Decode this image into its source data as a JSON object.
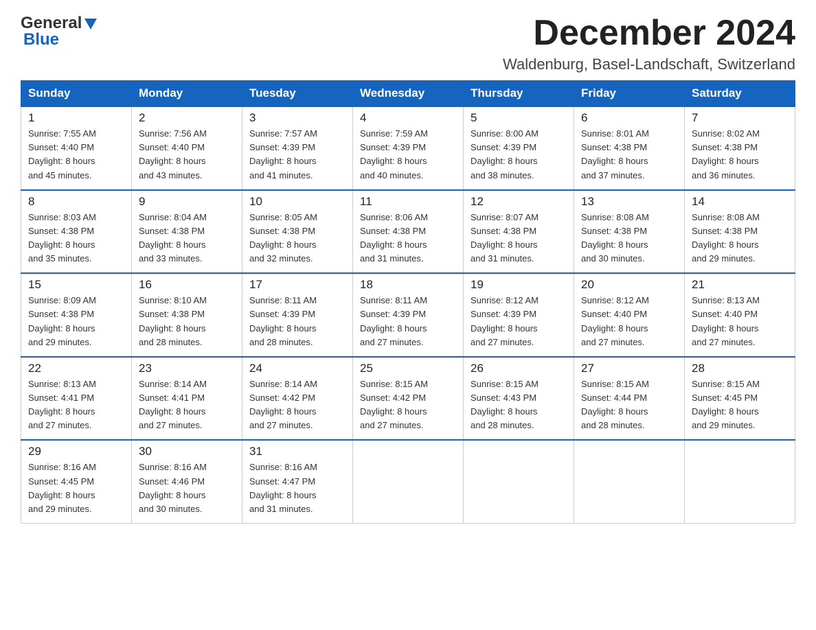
{
  "header": {
    "logo_general": "General",
    "logo_blue": "Blue",
    "month_title": "December 2024",
    "location": "Waldenburg, Basel-Landschaft, Switzerland"
  },
  "days_of_week": [
    "Sunday",
    "Monday",
    "Tuesday",
    "Wednesday",
    "Thursday",
    "Friday",
    "Saturday"
  ],
  "weeks": [
    [
      {
        "day": "1",
        "sunrise": "7:55 AM",
        "sunset": "4:40 PM",
        "daylight": "8 hours and 45 minutes."
      },
      {
        "day": "2",
        "sunrise": "7:56 AM",
        "sunset": "4:40 PM",
        "daylight": "8 hours and 43 minutes."
      },
      {
        "day": "3",
        "sunrise": "7:57 AM",
        "sunset": "4:39 PM",
        "daylight": "8 hours and 41 minutes."
      },
      {
        "day": "4",
        "sunrise": "7:59 AM",
        "sunset": "4:39 PM",
        "daylight": "8 hours and 40 minutes."
      },
      {
        "day": "5",
        "sunrise": "8:00 AM",
        "sunset": "4:39 PM",
        "daylight": "8 hours and 38 minutes."
      },
      {
        "day": "6",
        "sunrise": "8:01 AM",
        "sunset": "4:38 PM",
        "daylight": "8 hours and 37 minutes."
      },
      {
        "day": "7",
        "sunrise": "8:02 AM",
        "sunset": "4:38 PM",
        "daylight": "8 hours and 36 minutes."
      }
    ],
    [
      {
        "day": "8",
        "sunrise": "8:03 AM",
        "sunset": "4:38 PM",
        "daylight": "8 hours and 35 minutes."
      },
      {
        "day": "9",
        "sunrise": "8:04 AM",
        "sunset": "4:38 PM",
        "daylight": "8 hours and 33 minutes."
      },
      {
        "day": "10",
        "sunrise": "8:05 AM",
        "sunset": "4:38 PM",
        "daylight": "8 hours and 32 minutes."
      },
      {
        "day": "11",
        "sunrise": "8:06 AM",
        "sunset": "4:38 PM",
        "daylight": "8 hours and 31 minutes."
      },
      {
        "day": "12",
        "sunrise": "8:07 AM",
        "sunset": "4:38 PM",
        "daylight": "8 hours and 31 minutes."
      },
      {
        "day": "13",
        "sunrise": "8:08 AM",
        "sunset": "4:38 PM",
        "daylight": "8 hours and 30 minutes."
      },
      {
        "day": "14",
        "sunrise": "8:08 AM",
        "sunset": "4:38 PM",
        "daylight": "8 hours and 29 minutes."
      }
    ],
    [
      {
        "day": "15",
        "sunrise": "8:09 AM",
        "sunset": "4:38 PM",
        "daylight": "8 hours and 29 minutes."
      },
      {
        "day": "16",
        "sunrise": "8:10 AM",
        "sunset": "4:38 PM",
        "daylight": "8 hours and 28 minutes."
      },
      {
        "day": "17",
        "sunrise": "8:11 AM",
        "sunset": "4:39 PM",
        "daylight": "8 hours and 28 minutes."
      },
      {
        "day": "18",
        "sunrise": "8:11 AM",
        "sunset": "4:39 PM",
        "daylight": "8 hours and 27 minutes."
      },
      {
        "day": "19",
        "sunrise": "8:12 AM",
        "sunset": "4:39 PM",
        "daylight": "8 hours and 27 minutes."
      },
      {
        "day": "20",
        "sunrise": "8:12 AM",
        "sunset": "4:40 PM",
        "daylight": "8 hours and 27 minutes."
      },
      {
        "day": "21",
        "sunrise": "8:13 AM",
        "sunset": "4:40 PM",
        "daylight": "8 hours and 27 minutes."
      }
    ],
    [
      {
        "day": "22",
        "sunrise": "8:13 AM",
        "sunset": "4:41 PM",
        "daylight": "8 hours and 27 minutes."
      },
      {
        "day": "23",
        "sunrise": "8:14 AM",
        "sunset": "4:41 PM",
        "daylight": "8 hours and 27 minutes."
      },
      {
        "day": "24",
        "sunrise": "8:14 AM",
        "sunset": "4:42 PM",
        "daylight": "8 hours and 27 minutes."
      },
      {
        "day": "25",
        "sunrise": "8:15 AM",
        "sunset": "4:42 PM",
        "daylight": "8 hours and 27 minutes."
      },
      {
        "day": "26",
        "sunrise": "8:15 AM",
        "sunset": "4:43 PM",
        "daylight": "8 hours and 28 minutes."
      },
      {
        "day": "27",
        "sunrise": "8:15 AM",
        "sunset": "4:44 PM",
        "daylight": "8 hours and 28 minutes."
      },
      {
        "day": "28",
        "sunrise": "8:15 AM",
        "sunset": "4:45 PM",
        "daylight": "8 hours and 29 minutes."
      }
    ],
    [
      {
        "day": "29",
        "sunrise": "8:16 AM",
        "sunset": "4:45 PM",
        "daylight": "8 hours and 29 minutes."
      },
      {
        "day": "30",
        "sunrise": "8:16 AM",
        "sunset": "4:46 PM",
        "daylight": "8 hours and 30 minutes."
      },
      {
        "day": "31",
        "sunrise": "8:16 AM",
        "sunset": "4:47 PM",
        "daylight": "8 hours and 31 minutes."
      },
      null,
      null,
      null,
      null
    ]
  ],
  "labels": {
    "sunrise_prefix": "Sunrise: ",
    "sunset_prefix": "Sunset: ",
    "daylight_prefix": "Daylight: "
  }
}
